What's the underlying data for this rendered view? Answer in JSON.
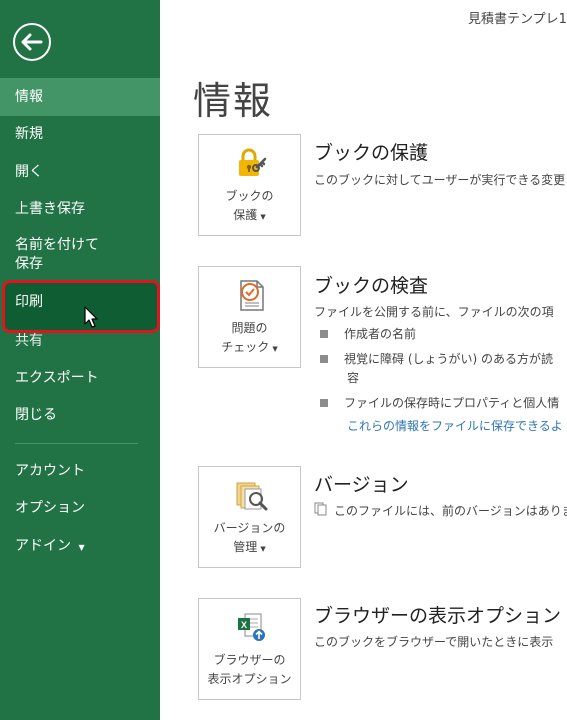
{
  "window": {
    "title": "見積書テンプレ1"
  },
  "sidebar": {
    "items": [
      {
        "label": "情報"
      },
      {
        "label": "新規"
      },
      {
        "label": "開く"
      },
      {
        "label": "上書き保存"
      },
      {
        "label": "名前を付けて"
      },
      {
        "label": "保存"
      },
      {
        "label": "印刷"
      },
      {
        "label": "共有"
      },
      {
        "label": "エクスポート"
      },
      {
        "label": "閉じる"
      },
      {
        "label": "アカウント"
      },
      {
        "label": "オプション"
      },
      {
        "label": "アドイン"
      }
    ]
  },
  "main": {
    "title": "情報",
    "protect": {
      "button_line1": "ブックの",
      "button_line2": "保護",
      "title": "ブックの保護",
      "desc": "このブックに対してユーザーが実行できる変更"
    },
    "inspect": {
      "button_line1": "問題の",
      "button_line2": "チェック",
      "title": "ブックの検査",
      "desc": "ファイルを公開する前に、ファイルの次の項",
      "bullets": [
        "作成者の名前",
        "視覚に障碍 (しょうがい) のある方が読",
        "容",
        "ファイルの保存時にプロパティと個人情"
      ],
      "link": "これらの情報をファイルに保存できるよ"
    },
    "versions": {
      "button_line1": "バージョンの",
      "button_line2": "管理",
      "title": "バージョン",
      "desc": "このファイルには、前のバージョンはありま"
    },
    "browser": {
      "button_line1": "ブラウザーの",
      "button_line2": "表示オプション",
      "title": "ブラウザーの表示オプション",
      "desc": "このブックをブラウザーで開いたときに表示"
    }
  },
  "colors": {
    "sidebar": "#217346",
    "sidebar_active": "#439467",
    "highlight_border": "#e0141e",
    "link": "#2e75b6"
  }
}
